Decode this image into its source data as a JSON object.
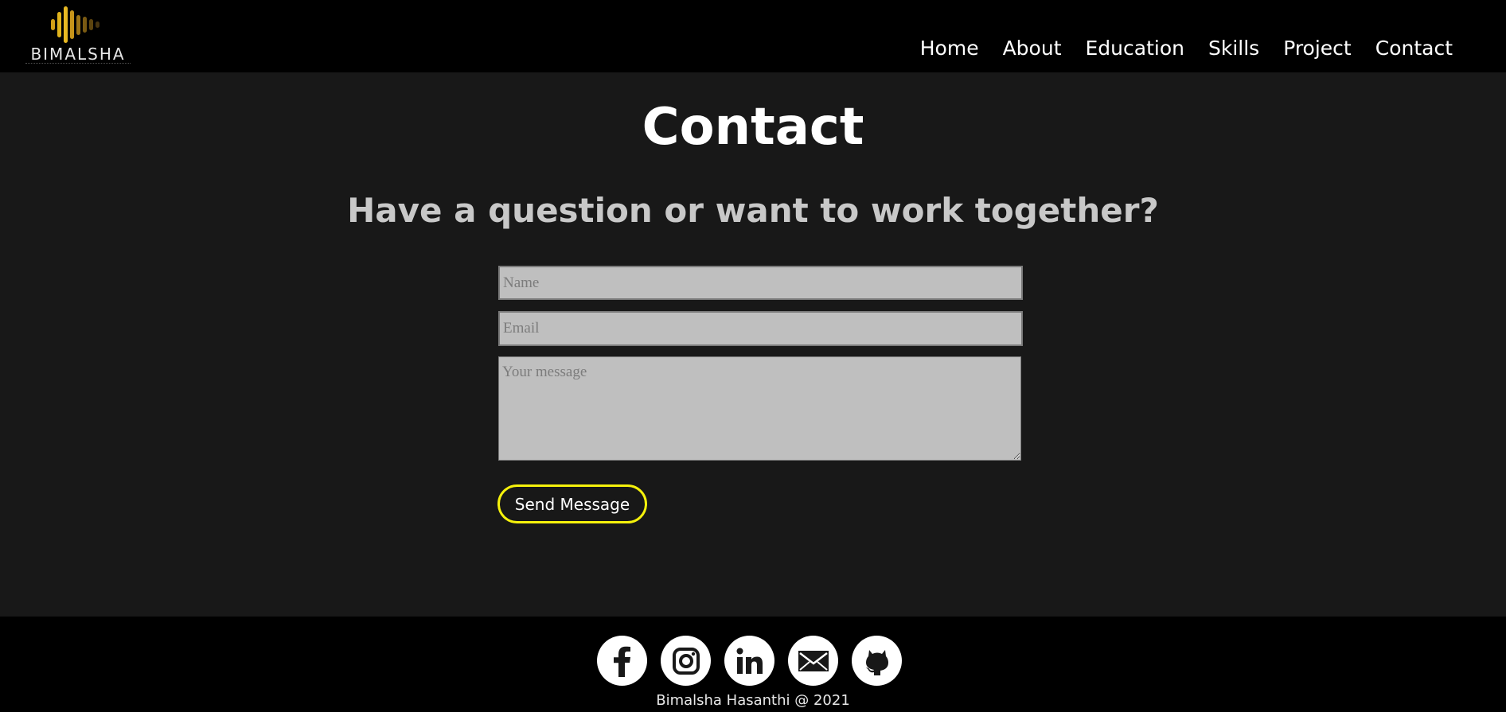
{
  "header": {
    "logo_text": "BIMALSHA",
    "nav": [
      "Home",
      "About",
      "Education",
      "Skills",
      "Project",
      "Contact"
    ]
  },
  "main": {
    "title": "Contact",
    "subtitle": "Have a question or want to work together?",
    "form": {
      "name_placeholder": "Name",
      "email_placeholder": "Email",
      "message_placeholder": "Your message",
      "name_value": "",
      "email_value": "",
      "message_value": "",
      "submit_label": "Send Message"
    }
  },
  "footer": {
    "socials": [
      "facebook-icon",
      "instagram-icon",
      "linkedin-icon",
      "mail-icon",
      "github-icon"
    ],
    "copyright": "Bimalsha Hasanthi @ 2021"
  },
  "colors": {
    "header_bg": "#000000",
    "page_bg": "#181818",
    "input_bg": "#bfbfbf",
    "button_border": "#f5f10b",
    "logo_gold": "#d4a017"
  }
}
